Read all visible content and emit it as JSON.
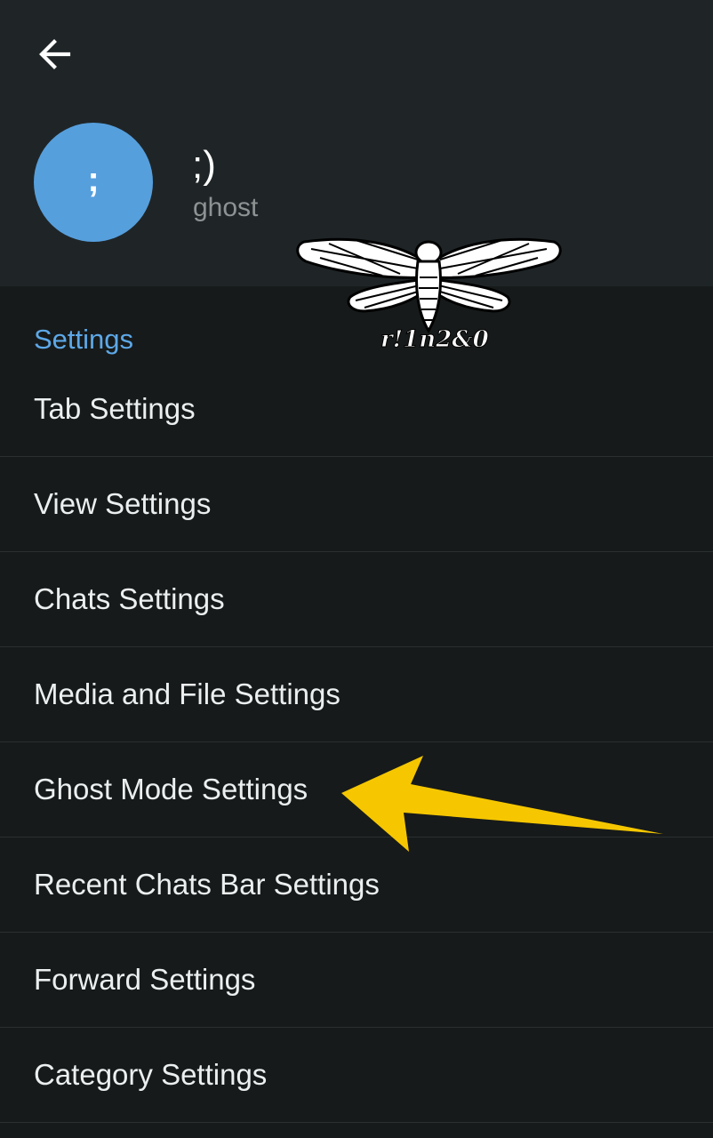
{
  "header": {
    "profile_name": ";)",
    "profile_status": "ghost",
    "avatar_letter": ";",
    "back_icon": "arrow-left-icon"
  },
  "watermark": {
    "text": "r!1n2&0"
  },
  "settings": {
    "section_title": "Settings",
    "items": [
      {
        "label": "Tab Settings"
      },
      {
        "label": "View Settings"
      },
      {
        "label": "Chats Settings"
      },
      {
        "label": "Media and File Settings"
      },
      {
        "label": "Ghost Mode Settings"
      },
      {
        "label": "Recent Chats Bar Settings"
      },
      {
        "label": "Forward Settings"
      },
      {
        "label": "Category Settings"
      }
    ]
  },
  "colors": {
    "header_bg": "#1f2527",
    "page_bg": "#171a1a",
    "accent": "#5da8e8",
    "avatar": "#569fdd",
    "arrow": "#f6c700"
  }
}
